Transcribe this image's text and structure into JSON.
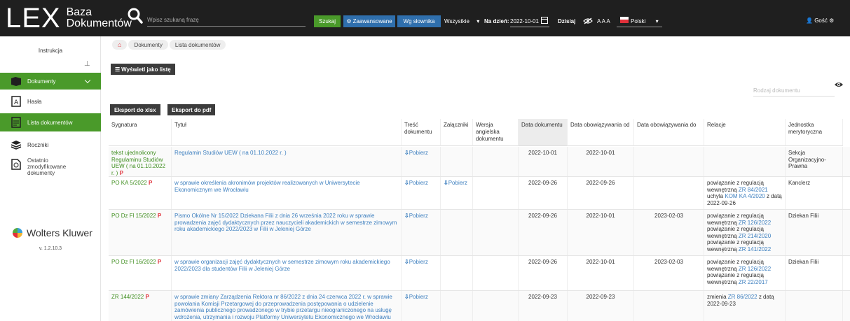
{
  "header": {
    "logo_main": "LEX",
    "logo_sub_1": "Baza",
    "logo_sub_2": "Dokumentów",
    "search_placeholder": "Wpisz szukaną frazę",
    "search_button": "Szukaj",
    "advanced_button": "Zaawansowane",
    "dictionary_button": "Wg słownika",
    "scope_select": "Wszystkie",
    "date_label": "Na dzień:",
    "date_value": "2022-10-01",
    "today_label": "Dzisiaj",
    "font_sizes": "A A A",
    "language": "Polski",
    "user": "Gość"
  },
  "sidebar": {
    "instructions": "Instrukcja",
    "items": [
      {
        "label": "Dokumenty",
        "icon": "book-icon"
      },
      {
        "label": "Hasła",
        "icon": "keyword-icon"
      },
      {
        "label": "Lista dokumentów",
        "icon": "document-list-icon"
      },
      {
        "label": "Roczniki",
        "icon": "stack-icon"
      },
      {
        "label": "Ostatnio zmodyfikowane dokumenty",
        "icon": "recent-docs-icon"
      }
    ],
    "brand": "Wolters Kluwer",
    "version": "v. 1.2.10.3"
  },
  "breadcrumb": [
    "Dokumenty",
    "Lista dokumentów"
  ],
  "toolbar": {
    "list_view_button": "Wyświetl jako listę",
    "export_xlsx": "Eksport do xlsx",
    "export_pdf": "Eksport do pdf",
    "doc_type_placeholder": "Rodzaj dokumentu"
  },
  "table": {
    "columns": [
      "Sygnatura",
      "Tytuł",
      "Treść dokumentu",
      "Załączniki",
      "Wersja angielska dokumentu",
      "Data dokumentu",
      "Data obowiązywania od",
      "Data obowiązywania do",
      "Relacje",
      "Jednostka merytoryczna"
    ],
    "download_label": "Pobierz",
    "rows": [
      {
        "sig": "tekst ujednolicony Regulaminu Studiów UEW ( na 01.10.2022 r. )",
        "p": "P",
        "title": "Regulamin Studiów UEW ( na 01.10.2022 r. )",
        "content": true,
        "attachments": false,
        "date_doc": "2022-10-01",
        "date_from": "2022-10-01",
        "date_to": "",
        "relations": [],
        "unit": "Sekcja Organizacyjno-Prawna"
      },
      {
        "sig": "PO KA 5/2022",
        "p": "P",
        "title": "w sprawie określenia akronimów projektów realizowanych w Uniwersytecie Ekonomicznym we Wrocławiu",
        "content": true,
        "attachments": true,
        "date_doc": "2022-09-26",
        "date_from": "2022-09-26",
        "date_to": "",
        "relations": [
          {
            "text": "powiązanie z regulacją wewnętrzną ",
            "link": "ZR 84/2021",
            "after": ""
          },
          {
            "text": "uchyla ",
            "link": "KOM KA 4/2020",
            "after": " z datą 2022-09-26"
          }
        ],
        "unit": "Kanclerz"
      },
      {
        "sig": "PO Dz Fl 15/2022",
        "p": "P",
        "title": "Pismo Okólne Nr 15/2022 Dziekana Filii z dnia 26 września 2022 roku w sprawie prowadzenia zajęć dydaktycznych przez nauczycieli akademickich w semestrze zimowym roku akademickiego 2022/2023 w Filii w Jeleniej Górze",
        "content": true,
        "attachments": false,
        "date_doc": "2022-09-26",
        "date_from": "2022-10-01",
        "date_to": "2023-02-03",
        "relations": [
          {
            "text": "powiązanie z regulacją wewnętrzną ",
            "link": "ZR 126/2022",
            "after": ""
          },
          {
            "text": "powiązanie z regulacją wewnętrzną ",
            "link": "ZR 214/2020",
            "after": ""
          },
          {
            "text": "powiązanie z regulacją wewnętrzną ",
            "link": "ZR 141/2022",
            "after": ""
          }
        ],
        "unit": "Dziekan Filii"
      },
      {
        "sig": "PO Dz Fl 16/2022",
        "p": "P",
        "title": "w sprawie organizacji zajęć dydaktycznych w semestrze zimowym roku akademickiego 2022/2023 dla studentów Filii w Jeleniej Górze",
        "content": true,
        "attachments": false,
        "date_doc": "2022-09-26",
        "date_from": "2022-10-01",
        "date_to": "2023-02-03",
        "relations": [
          {
            "text": "powiązanie z regulacją wewnętrzną ",
            "link": "ZR 126/2022",
            "after": ""
          },
          {
            "text": "powiązanie z regulacją wewnętrzną ",
            "link": "ZR 22/2017",
            "after": ""
          }
        ],
        "unit": "Dziekan Filii"
      },
      {
        "sig": "ZR 144/2022",
        "p": "P",
        "title": "w sprawie zmiany Zarządzenia Rektora nr 86/2022 z dnia 24 czerwca 2022 r. w sprawie powołania Komisji Przetargowej do przeprowadzenia postępowania o udzielenie zamówienia publicznego prowadzonego w trybie przetargu nieograniczonego na usługę wdrożenia, utrzymania i rozwoju Platformy Uniwersytetu Ekonomicznego we Wrocławiu",
        "content": true,
        "attachments": false,
        "date_doc": "2022-09-23",
        "date_from": "2022-09-23",
        "date_to": "",
        "relations": [
          {
            "text": "zmienia ",
            "link": "ZR 86/2022",
            "after": " z datą 2022-09-23"
          }
        ],
        "unit": ""
      }
    ]
  }
}
